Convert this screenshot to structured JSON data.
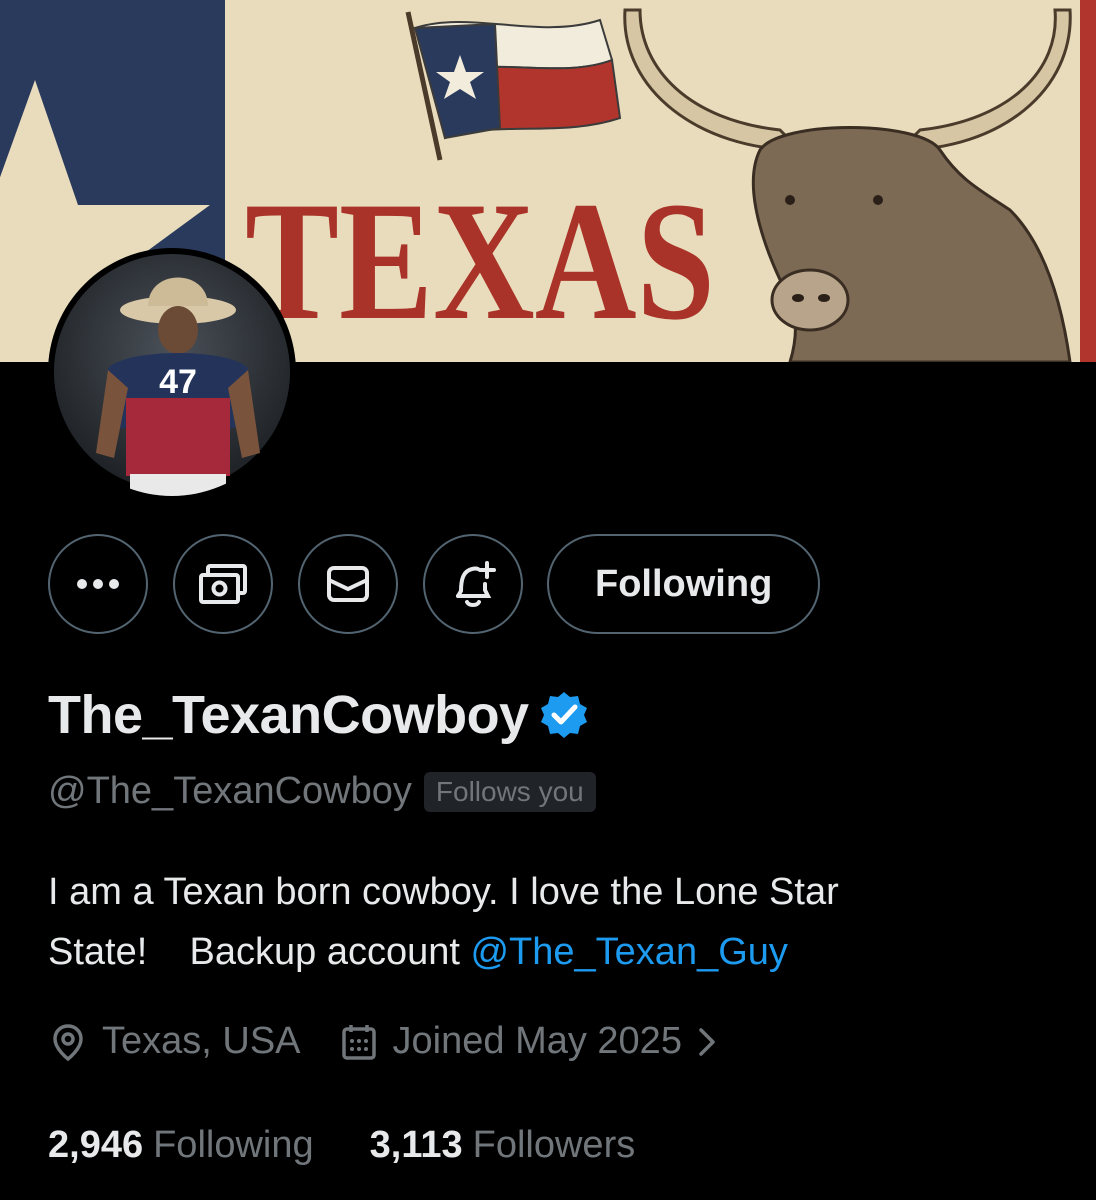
{
  "banner": {
    "title": "TEXAS"
  },
  "profile": {
    "display_name": "The_TexanCowboy",
    "handle": "@The_TexanCowboy",
    "follows_you_badge": "Follows you",
    "bio_text": "I am a Texan born cowboy. I love the Lone Star State!    Backup account ",
    "bio_mention": "@The_Texan_Guy",
    "location": "Texas, USA",
    "joined": "Joined May 2025",
    "following_count": "2,946",
    "following_label": "Following",
    "followers_count": "3,113",
    "followers_label": "Followers",
    "avatar_jersey_number": "47"
  },
  "actions": {
    "more_icon": "more-icon",
    "subscribe_icon": "money-icon",
    "message_icon": "envelope-icon",
    "notify_icon": "bell-plus-icon",
    "follow_label": "Following"
  },
  "colors": {
    "background": "#000000",
    "accent": "#1d9bf0",
    "secondary_text": "#71767b",
    "banner_red": "#b2352d",
    "banner_blue": "#2a3a5c",
    "banner_cream": "#e9dcbc"
  }
}
